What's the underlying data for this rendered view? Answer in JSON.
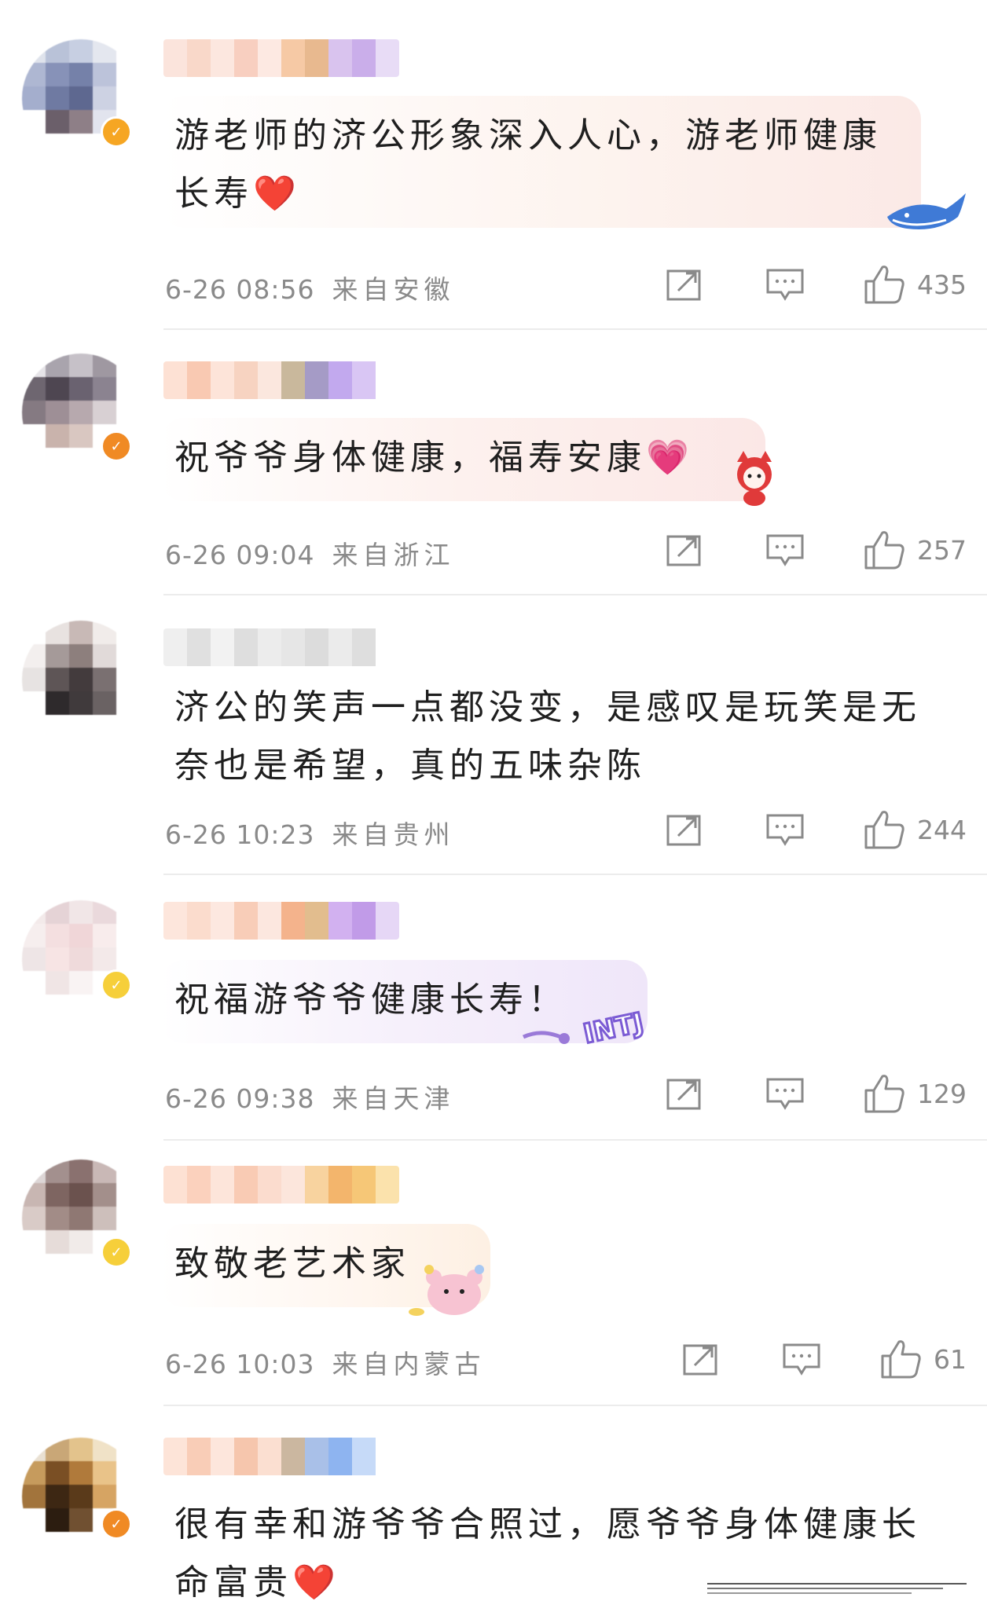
{
  "comments": [
    {
      "text": "游老师的济公形象深入人心，游老师健康长寿",
      "emoji": "❤️",
      "timestamp": "6-26 08:56",
      "location": "来自安徽",
      "likes": "435"
    },
    {
      "text": "祝爷爷身体健康，福寿安康",
      "emoji": "💗",
      "timestamp": "6-26 09:04",
      "location": "来自浙江",
      "likes": "257"
    },
    {
      "text": "济公的笑声一点都没变，是感叹是玩笑是无奈也是希望，真的五味杂陈",
      "emoji": "",
      "timestamp": "6-26 10:23",
      "location": "来自贵州",
      "likes": "244"
    },
    {
      "text": "祝福游爷爷健康长寿！",
      "emoji": "",
      "sticker": "INTJ",
      "timestamp": "6-26 09:38",
      "location": "来自天津",
      "likes": "129"
    },
    {
      "text": "致敬老艺术家",
      "emoji": "",
      "timestamp": "6-26 10:03",
      "location": "来自内蒙古",
      "likes": "61"
    },
    {
      "text": "很有幸和游爷爷合照过，愿爷爷身体健康长命富贵",
      "emoji": "❤️"
    }
  ],
  "icons": {
    "share": "share-icon",
    "reply": "comment-icon",
    "like": "thumbs-up-icon"
  },
  "colors": {
    "text": "#1f1f1f",
    "meta": "#8a8a8a",
    "badge": "#f6a623",
    "heart": "#e02a2a"
  }
}
